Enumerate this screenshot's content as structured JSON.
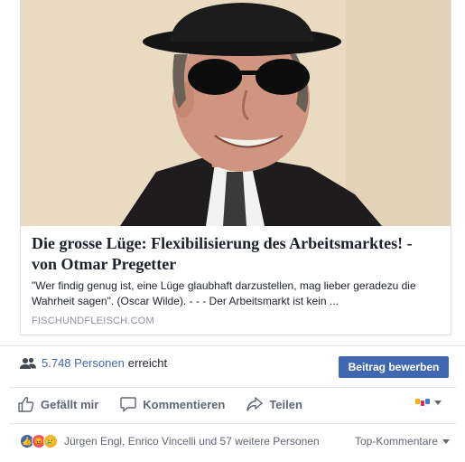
{
  "link_preview": {
    "title": "Die grosse Lüge: Flexibilisierung des Arbeitsmarktes! - von Otmar Pregetter",
    "description": "\"Wer findig genug ist, eine Lüge glaubhaft darzustellen, mag lieber geradezu die Wahrheit sagen\". (Oscar Wilde). - - - Der Arbeitsmarkt ist kein ...",
    "domain": "FISCHUNDFLEISCH.COM",
    "image_icon": "portrait-photo"
  },
  "reach": {
    "count": "5.748 Personen",
    "label": "erreicht",
    "icon": "people-icon"
  },
  "promote_button": "Beitrag bewerben",
  "actions": {
    "like": "Gefällt mir",
    "comment": "Kommentieren",
    "share": "Teilen"
  },
  "reactions": {
    "summary": "Jürgen Engl, Enrico Vincelli und 57 weitere Personen",
    "sort": "Top-Kommentare"
  },
  "colors": {
    "accent": "#4267b2",
    "secondary_text": "#606770",
    "border": "#dddfe2"
  }
}
